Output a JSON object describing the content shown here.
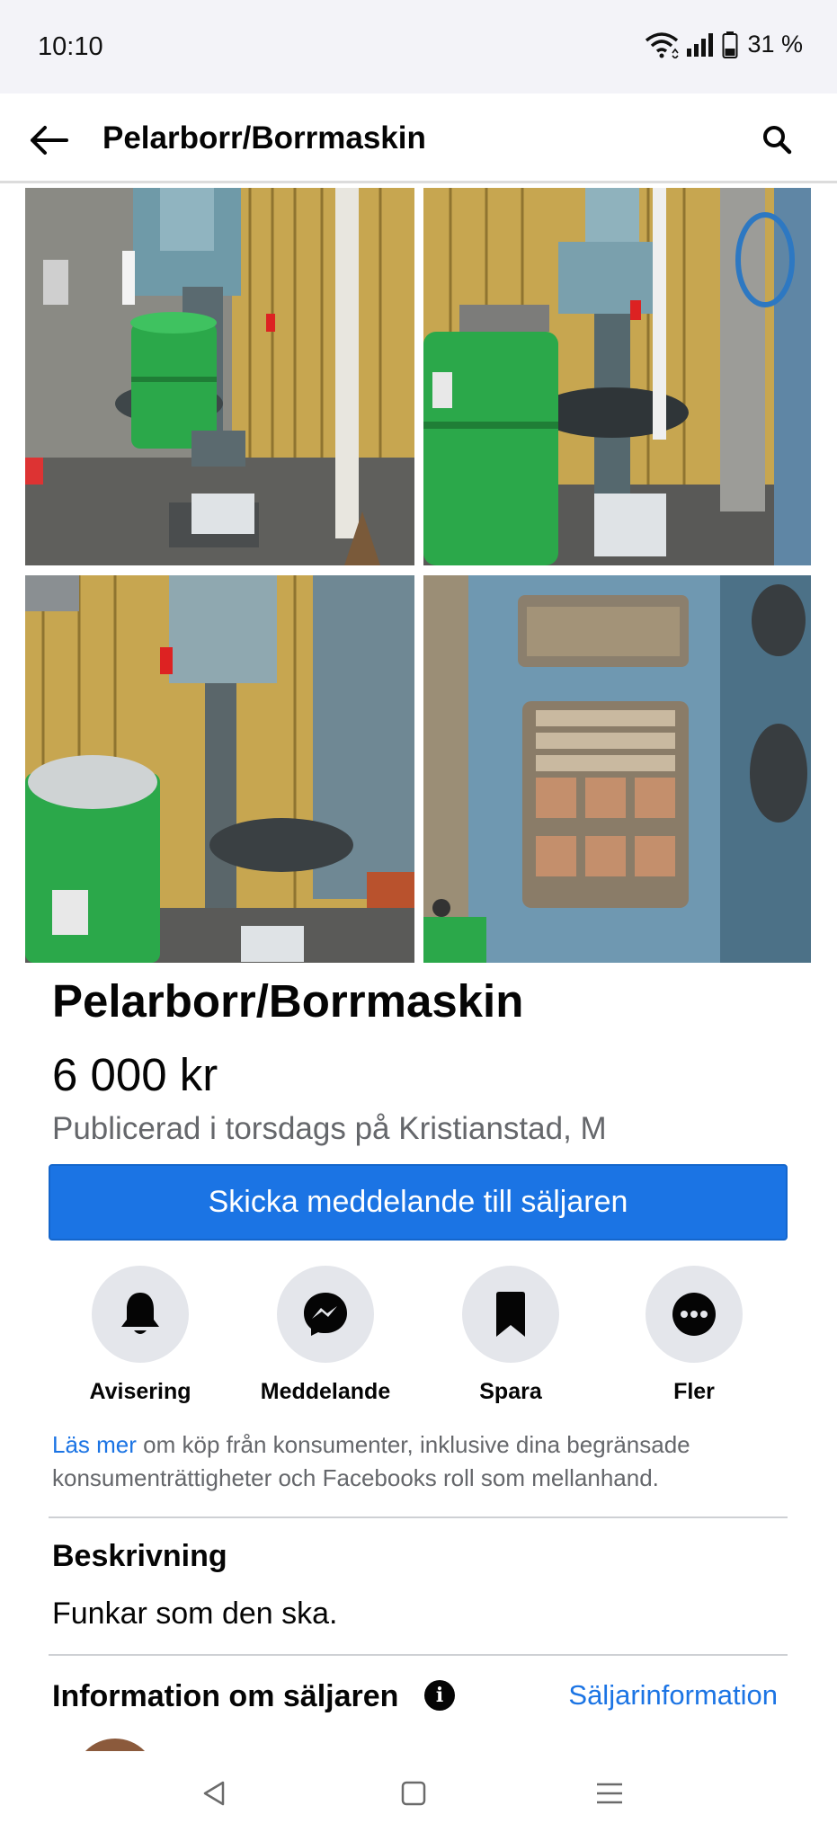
{
  "status_bar": {
    "time": "10:10",
    "battery": "31 %"
  },
  "header": {
    "title": "Pelarborr/Borrmaskin",
    "back_icon": "arrow-left-icon",
    "search_icon": "search-icon"
  },
  "listing": {
    "title": "Pelarborr/Borrmaskin",
    "price": "6 000 kr",
    "meta": "Publicerad i torsdags på Kristianstad, M"
  },
  "primary_action": {
    "label": "Skicka meddelande till säljaren",
    "color": "#1b74e4"
  },
  "actions": [
    {
      "label": "Avisering",
      "icon": "bell-icon"
    },
    {
      "label": "Meddelande",
      "icon": "messenger-icon"
    },
    {
      "label": "Spara",
      "icon": "bookmark-icon"
    },
    {
      "label": "Fler",
      "icon": "more-icon"
    }
  ],
  "info": {
    "link": "Läs mer",
    "text": " om köp från konsumenter, inklusive dina begränsade konsumenträttigheter och Facebooks roll som mellanhand."
  },
  "description": {
    "heading": "Beskrivning",
    "body": "Funkar som den ska."
  },
  "seller": {
    "heading": "Information om säljaren",
    "link": "Säljarinformation"
  },
  "nav": {
    "back_icon": "triangle-back-icon",
    "home_icon": "square-home-icon",
    "menu_icon": "menu-lines-icon"
  }
}
